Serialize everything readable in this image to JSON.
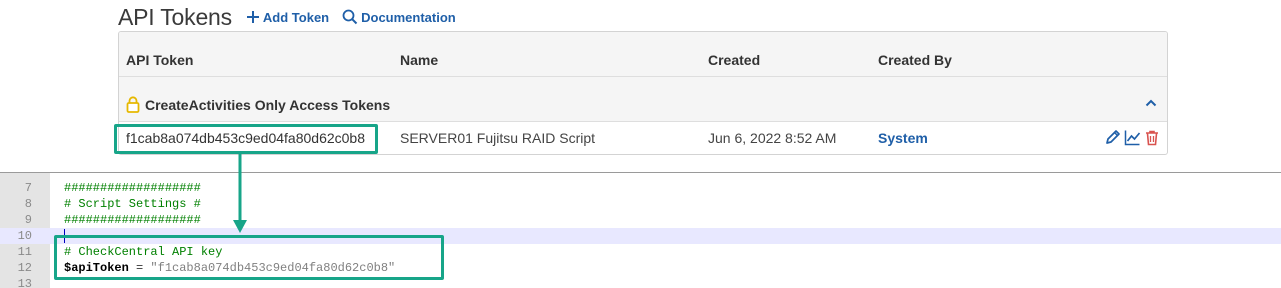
{
  "header": {
    "title": "API Tokens",
    "add_token_label": "Add Token",
    "documentation_label": "Documentation"
  },
  "table": {
    "columns": [
      "API Token",
      "Name",
      "Created",
      "Created By"
    ],
    "group": {
      "title": "CreateActivities Only Access Tokens"
    },
    "rows": [
      {
        "token": "f1cab8a074db453c9ed04fa80d62c0b8",
        "name": "SERVER01 Fujitsu RAID Script",
        "created": "Jun 6, 2022 8:52 AM",
        "created_by": "System"
      }
    ]
  },
  "editor": {
    "lines": [
      {
        "num": "7",
        "text": "###################"
      },
      {
        "num": "8",
        "text": "# Script Settings #"
      },
      {
        "num": "9",
        "text": "###################"
      },
      {
        "num": "10",
        "text": ""
      },
      {
        "num": "11",
        "text": "# CheckCentral API key"
      },
      {
        "num": "12",
        "var": "$apiToken",
        "op": " = ",
        "str": "\"f1cab8a074db453c9ed04fa80d62c0b8\""
      },
      {
        "num": "13",
        "text": ""
      }
    ]
  },
  "colors": {
    "highlight": "#17a589",
    "link": "#1f5fa8",
    "comment": "#008000",
    "lock": "#e6b800",
    "delete": "#d9534f"
  },
  "icons": [
    "plus-icon",
    "search-icon",
    "lock-icon",
    "chevron-up-icon",
    "edit-icon",
    "chart-icon",
    "trash-icon"
  ]
}
